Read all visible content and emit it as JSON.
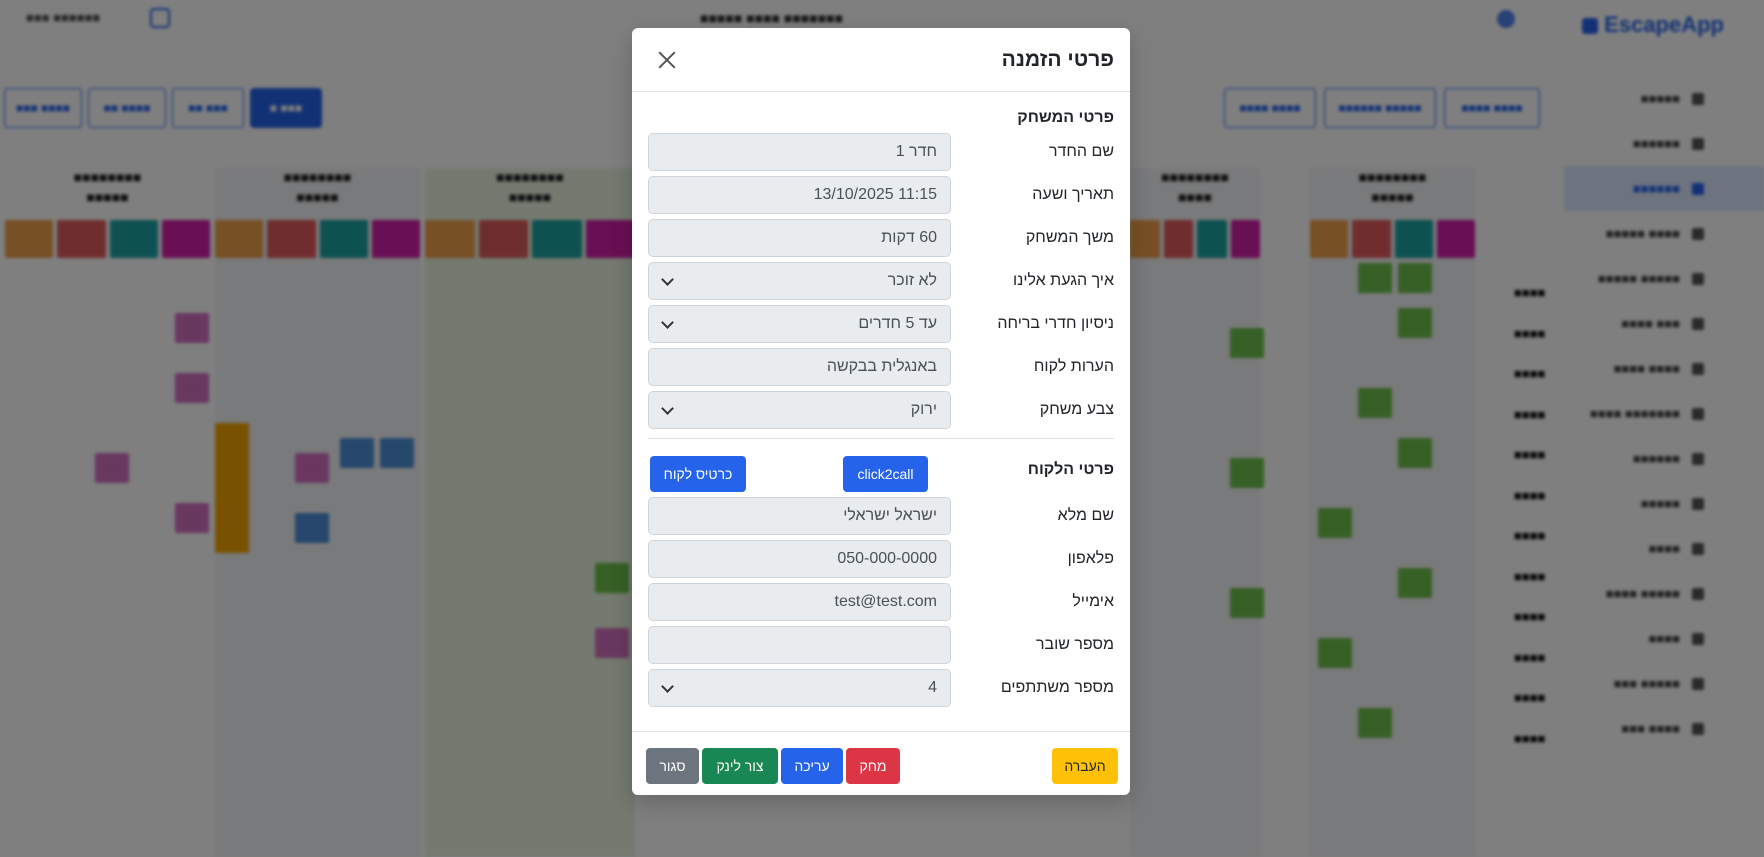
{
  "app": {
    "logo": "EscapeApp"
  },
  "modal": {
    "title": "פרטי הזמנה",
    "game_section_title": "פרטי המשחק",
    "game_fields": [
      {
        "label": "שם החדר",
        "value": "חדר 1",
        "type": "text"
      },
      {
        "label": "תאריך ושעה",
        "value": "11:15 13/10/2025",
        "type": "text"
      },
      {
        "label": "משך המשחק",
        "value": "60 דקות",
        "type": "text"
      },
      {
        "label": "איך הגעת אלינו",
        "value": "לא זוכר",
        "type": "select"
      },
      {
        "label": "ניסיון חדרי בריחה",
        "value": "עד 5 חדרים",
        "type": "select"
      },
      {
        "label": "הערות לקוח",
        "value": "באנגלית בבקשה",
        "type": "text"
      },
      {
        "label": "צבע משחק",
        "value": "ירוק",
        "type": "select"
      }
    ],
    "customer_section_title": "פרטי הלקוח",
    "click2call_label": "click2call",
    "customer_card_label": "כרטיס לקוח",
    "customer_fields": [
      {
        "label": "שם מלא",
        "value": "ישראל ישראלי",
        "type": "text"
      },
      {
        "label": "פלאפון",
        "value": "050-000-0000",
        "type": "text"
      },
      {
        "label": "אימייל",
        "value": "test@test.com",
        "type": "text"
      },
      {
        "label": "מספר שובר",
        "value": "",
        "type": "text"
      },
      {
        "label": "מספר משתתפים",
        "value": "4",
        "type": "select"
      }
    ],
    "footer": {
      "transfer_label": "העברה",
      "delete_label": "מחק",
      "edit_label": "עריכה",
      "create_link_label": "צור לינק",
      "close_label": "סגור"
    }
  },
  "colors": {
    "primary": "#2563eb",
    "danger": "#dc3545",
    "success": "#198754",
    "secondary": "#6c757d",
    "warning": "#ffc107",
    "overlay": "rgba(0,0,0,0.5)"
  }
}
